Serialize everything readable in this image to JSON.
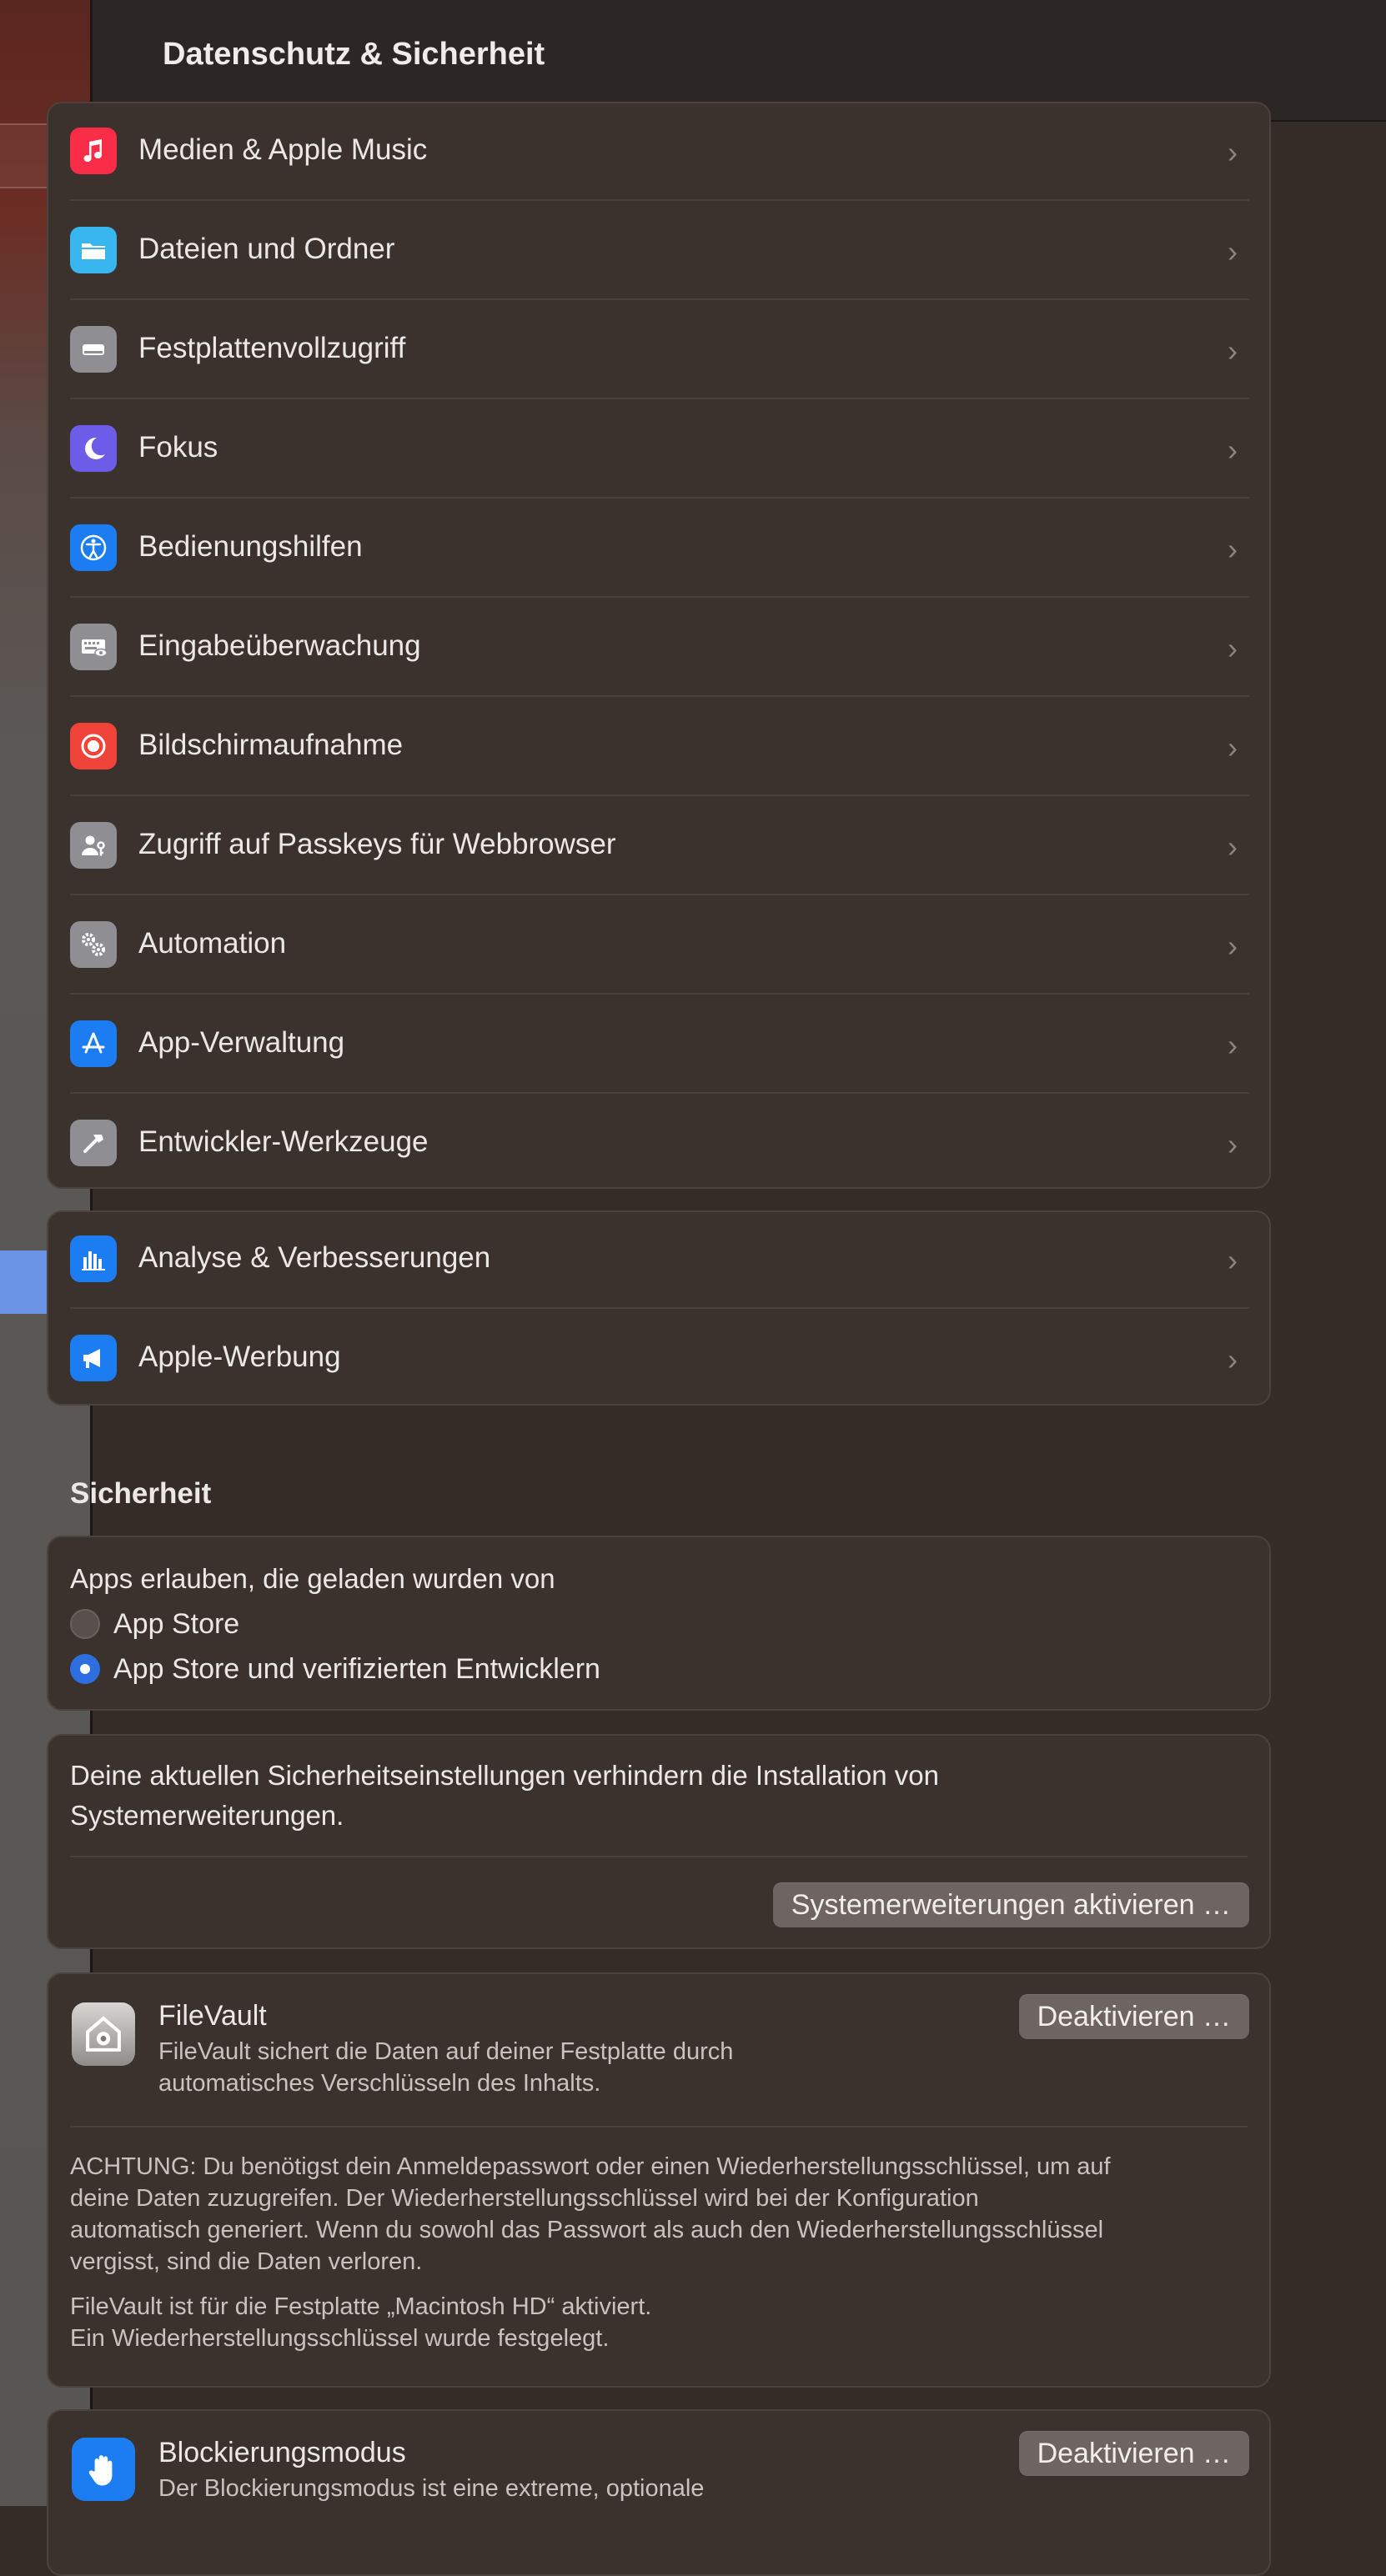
{
  "header": {
    "title": "Datenschutz & Sicherheit"
  },
  "privacy_items": [
    {
      "label": "Medien & Apple Music",
      "icon": "music-note-icon",
      "color": "#fa2d48"
    },
    {
      "label": "Dateien und Ordner",
      "icon": "folder-icon",
      "color": "#39b6f0"
    },
    {
      "label": "Festplattenvollzugriff",
      "icon": "disk-drive-icon",
      "color": "#8e8e93"
    },
    {
      "label": "Fokus",
      "icon": "moon-icon",
      "color": "#6c5ce7"
    },
    {
      "label": "Bedienungshilfen",
      "icon": "accessibility-icon",
      "color": "#1c7cf2"
    },
    {
      "label": "Eingabeüberwachung",
      "icon": "keyboard-eye-icon",
      "color": "#8e8e93"
    },
    {
      "label": "Bildschirmaufnahme",
      "icon": "screen-record-icon",
      "color": "#f0443a"
    },
    {
      "label": "Zugriff auf Passkeys für Webbrowser",
      "icon": "person-key-icon",
      "color": "#8e8e93"
    },
    {
      "label": "Automation",
      "icon": "gears-icon",
      "color": "#8e8e93"
    },
    {
      "label": "App-Verwaltung",
      "icon": "app-store-icon",
      "color": "#1c7cf2"
    },
    {
      "label": "Entwickler-Werkzeuge",
      "icon": "hammer-icon",
      "color": "#8e8e93"
    }
  ],
  "analytics_items": [
    {
      "label": "Analyse & Verbesserungen",
      "icon": "bar-chart-icon",
      "color": "#1c7cf2"
    },
    {
      "label": "Apple-Werbung",
      "icon": "megaphone-icon",
      "color": "#1c7cf2"
    }
  ],
  "security": {
    "title": "Sicherheit",
    "allow_apps_label": "Apps erlauben, die geladen wurden von",
    "options": [
      {
        "label": "App Store",
        "selected": false
      },
      {
        "label": "App Store und verifizierten Entwicklern",
        "selected": true
      }
    ],
    "extensions_text_1": "Deine aktuellen Sicherheitseinstellungen verhindern die Installation von",
    "extensions_text_2": "Systemerweiterungen.",
    "extensions_button": "Systemerweiterungen aktivieren …",
    "filevault": {
      "title": "FileVault",
      "desc_1": "FileVault sichert die Daten auf deiner Festplatte durch",
      "desc_2": "automatisches Verschlüsseln des Inhalts.",
      "button": "Deaktivieren …",
      "warning_1": "ACHTUNG: Du benötigst dein Anmeldepasswort oder einen Wiederherstellungsschlüssel, um auf",
      "warning_2": "deine Daten zuzugreifen. Der Wiederherstellungsschlüssel wird bei der Konfiguration",
      "warning_3": "automatisch generiert. Wenn du sowohl das Passwort als auch den Wiederherstellungsschlüssel",
      "warning_4": "vergisst, sind die Daten verloren.",
      "status_1": "FileVault ist für die Festplatte „Macintosh HD“ aktiviert.",
      "status_2": "Ein Wiederherstellungsschlüssel wurde festgelegt."
    },
    "lockdown": {
      "title": "Blockierungsmodus",
      "desc_1": "Der Blockierungsmodus ist eine extreme, optionale",
      "button": "Deaktivieren …"
    }
  }
}
